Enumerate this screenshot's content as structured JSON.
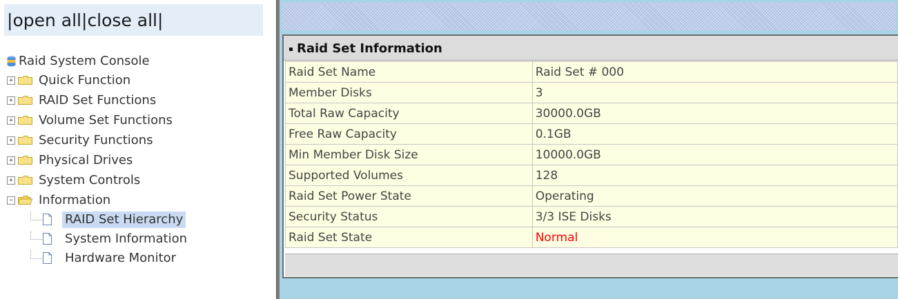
{
  "nav": {
    "open_all": "open all",
    "close_all": "close all",
    "root_label": "Raid System Console",
    "items": [
      {
        "label": "Quick Function",
        "expanded": false
      },
      {
        "label": "RAID Set Functions",
        "expanded": false
      },
      {
        "label": "Volume Set Functions",
        "expanded": false
      },
      {
        "label": "Security Functions",
        "expanded": false
      },
      {
        "label": "Physical Drives",
        "expanded": false
      },
      {
        "label": "System Controls",
        "expanded": false
      },
      {
        "label": "Information",
        "expanded": true
      }
    ],
    "children": [
      {
        "label": "RAID Set Hierarchy",
        "selected": true
      },
      {
        "label": "System Information",
        "selected": false
      },
      {
        "label": "Hardware Monitor",
        "selected": false
      }
    ]
  },
  "panel": {
    "title": "Raid Set Information",
    "rows": [
      {
        "key": "Raid Set Name",
        "value": "Raid Set # 000"
      },
      {
        "key": "Member Disks",
        "value": "3"
      },
      {
        "key": "Total Raw Capacity",
        "value": "30000.0GB"
      },
      {
        "key": "Free Raw Capacity",
        "value": "0.1GB"
      },
      {
        "key": "Min Member Disk Size",
        "value": "10000.0GB"
      },
      {
        "key": "Supported Volumes",
        "value": "128"
      },
      {
        "key": "Raid Set Power State",
        "value": "Operating"
      },
      {
        "key": "Security Status",
        "value": "3/3 ISE Disks"
      },
      {
        "key": "Raid Set State",
        "value": "Normal",
        "status_color": "#ff0000"
      }
    ]
  }
}
